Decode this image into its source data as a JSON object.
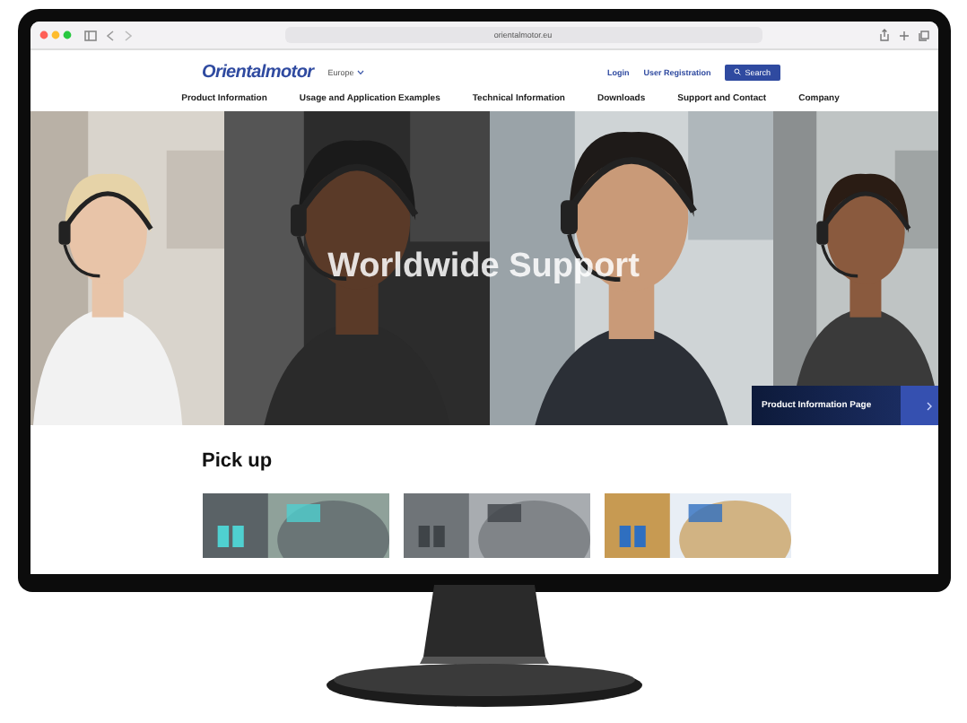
{
  "browser": {
    "url": "orientalmotor.eu"
  },
  "site": {
    "logo": "Orientalmotor",
    "region": "Europe",
    "login": "Login",
    "registration": "User Registration",
    "search": "Search"
  },
  "nav": [
    "Product Information",
    "Usage and Application Examples",
    "Technical Information",
    "Downloads",
    "Support and Contact",
    "Company"
  ],
  "hero": {
    "title": "Worldwide Support",
    "promo": "Product Information Page"
  },
  "pickup": {
    "heading": "Pick up"
  }
}
